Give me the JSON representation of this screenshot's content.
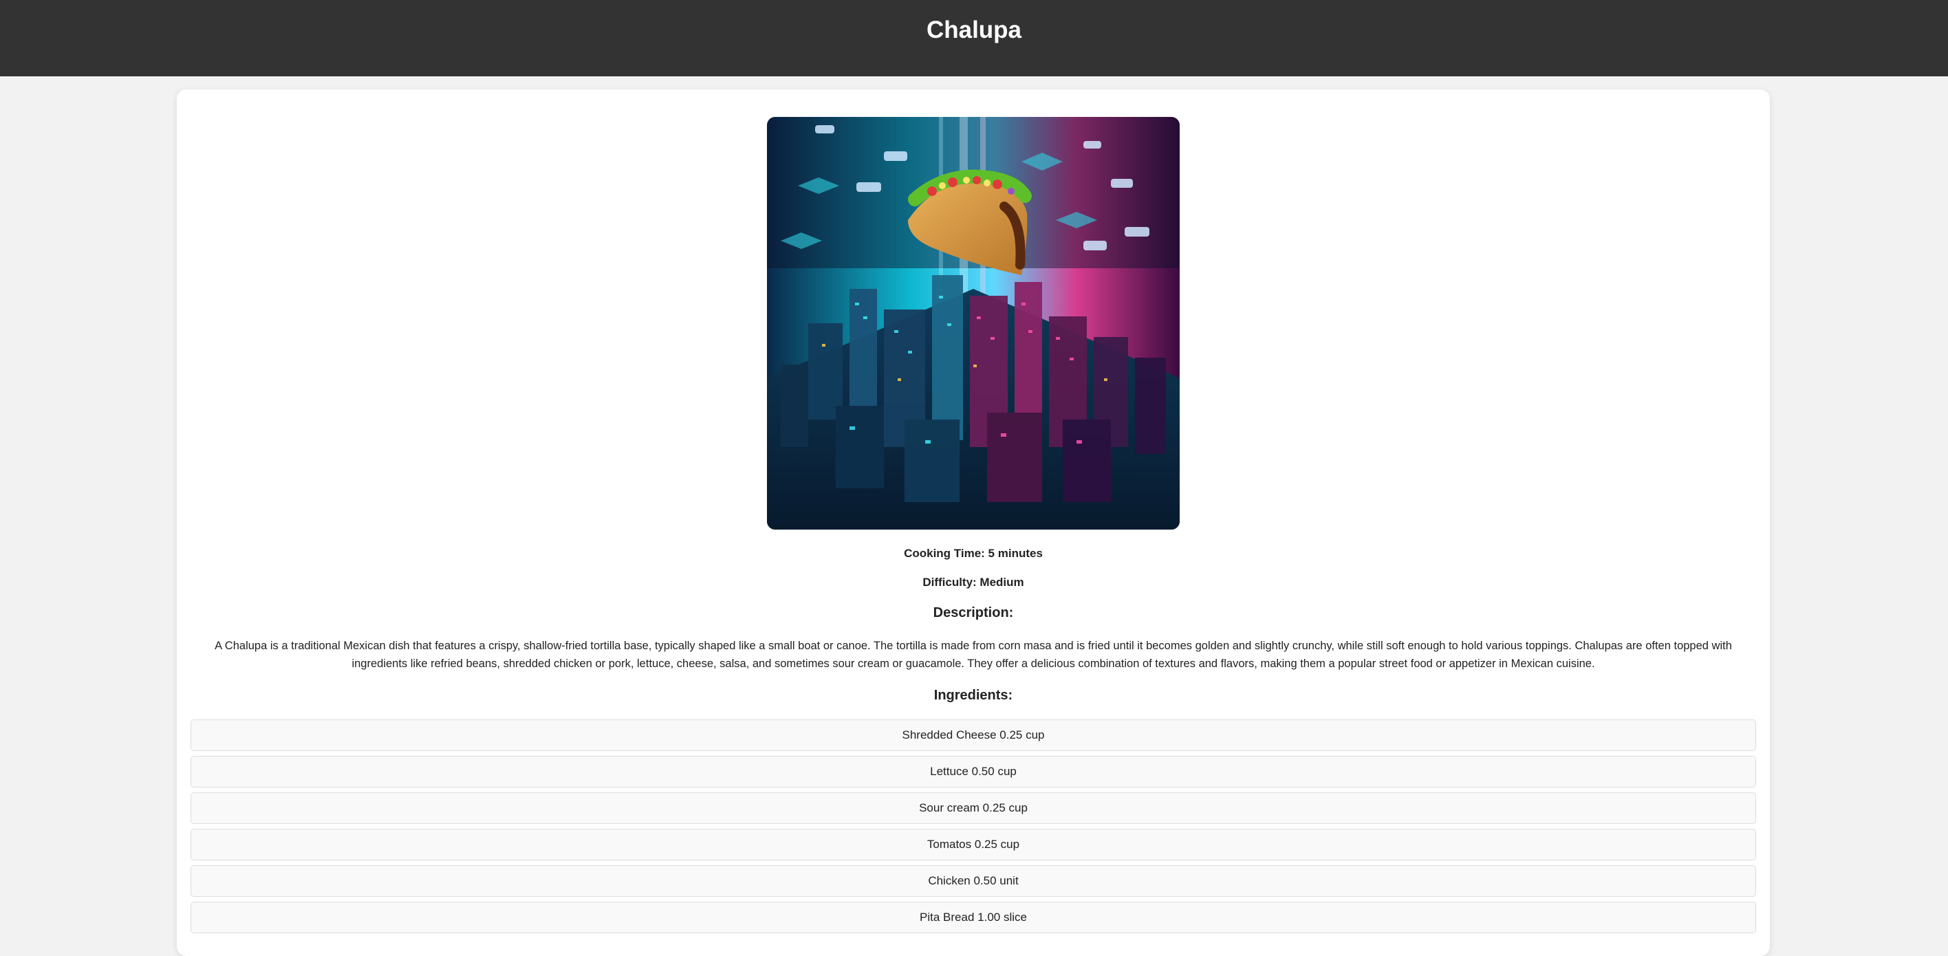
{
  "header": {
    "title": "Chalupa"
  },
  "recipe": {
    "image_icon": "chalupa-cyberpunk-city-image",
    "cooking_time": "Cooking Time: 5 minutes",
    "difficulty": "Difficulty: Medium",
    "description_heading": "Description:",
    "description": "A Chalupa is a traditional Mexican dish that features a crispy, shallow-fried tortilla base, typically shaped like a small boat or canoe. The tortilla is made from corn masa and is fried until it becomes golden and slightly crunchy, while still soft enough to hold various toppings. Chalupas are often topped with ingredients like refried beans, shredded chicken or pork, lettuce, cheese, salsa, and sometimes sour cream or guacamole. They offer a delicious combination of textures and flavors, making them a popular street food or appetizer in Mexican cuisine.",
    "ingredients_heading": "Ingredients:",
    "ingredients": [
      "Shredded Cheese 0.25 cup",
      "Lettuce 0.50 cup",
      "Sour cream 0.25 cup",
      "Tomatos 0.25 cup",
      "Chicken 0.50 unit",
      "Pita Bread 1.00 slice"
    ]
  },
  "colors": {
    "header_bg": "#333333",
    "page_bg": "#f2f2f2",
    "card_bg": "#ffffff",
    "ingredient_bg": "#f9f9f9",
    "ingredient_border": "#dddddd"
  }
}
